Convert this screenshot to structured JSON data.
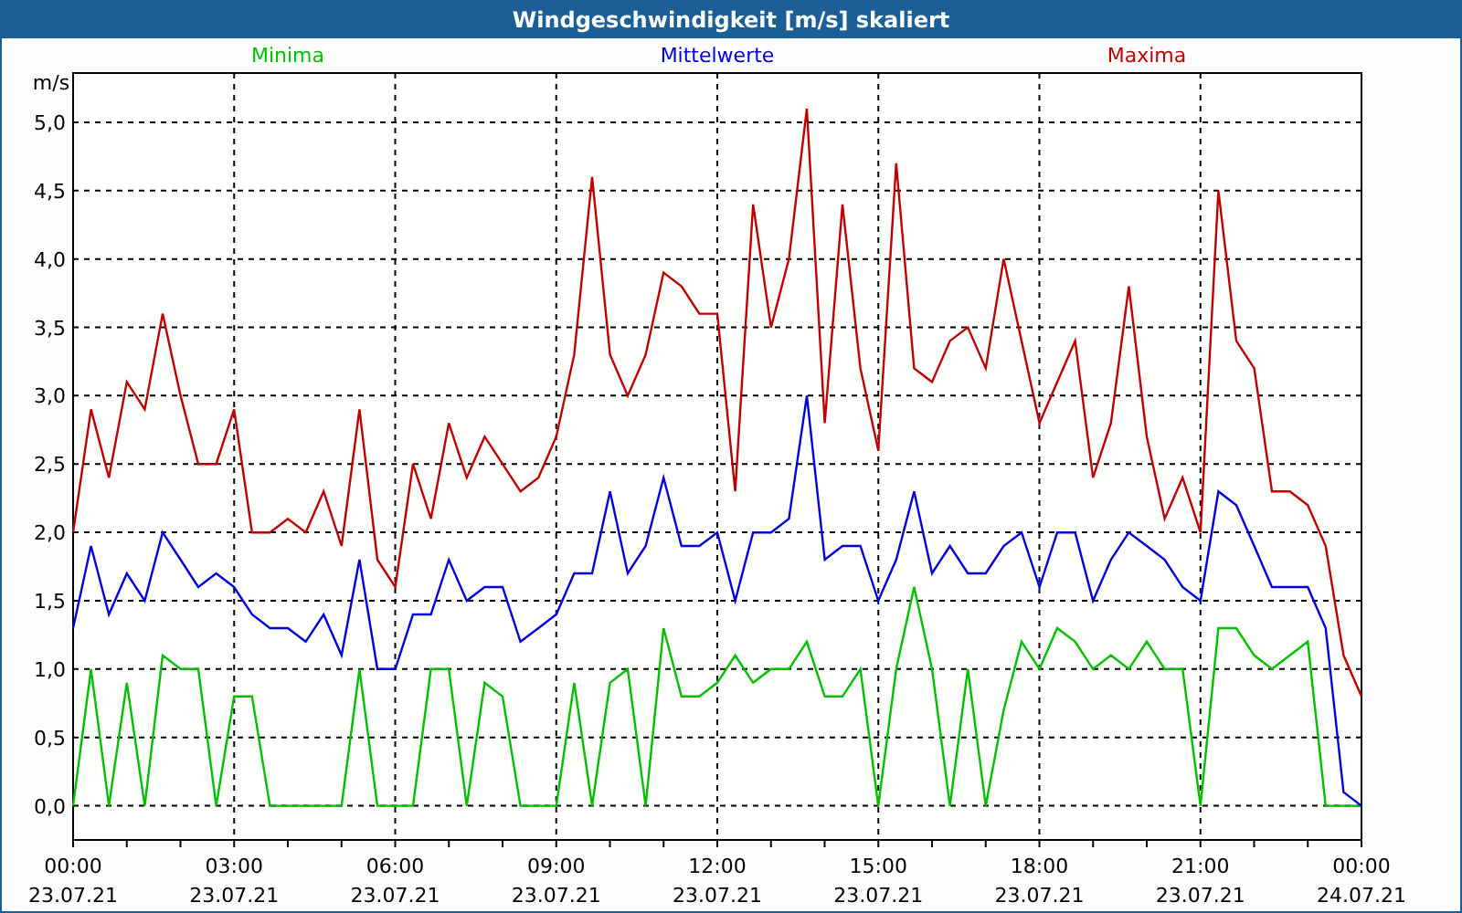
{
  "window": {
    "title": "Windgeschwindigkeit [m/s] skaliert"
  },
  "chart": {
    "chart_data": {
      "type": "line",
      "ylabel": "m/s",
      "categories": [
        "00:00 23.07.21",
        null,
        null,
        null,
        null,
        null,
        null,
        null,
        null,
        "03:00 23.07.21",
        null,
        null,
        null,
        null,
        null,
        null,
        null,
        null,
        "06:00 23.07.21",
        null,
        null,
        null,
        null,
        null,
        null,
        null,
        null,
        "09:00 23.07.21",
        null,
        null,
        null,
        null,
        null,
        null,
        null,
        null,
        "12:00 23.07.21",
        null,
        null,
        null,
        null,
        null,
        null,
        null,
        null,
        "15:00 23.07.21",
        null,
        null,
        null,
        null,
        null,
        null,
        null,
        null,
        "18:00 23.07.21",
        null,
        null,
        null,
        null,
        null,
        null,
        null,
        null,
        "21:00 23.07.21",
        null,
        null,
        null,
        null,
        null,
        null,
        null,
        null,
        "00:00 24.07.21"
      ],
      "series": [
        {
          "name": "Minima",
          "color": "#00c000",
          "values": [
            0.0,
            1.0,
            0.0,
            0.9,
            0.0,
            1.1,
            1.0,
            1.0,
            0.0,
            0.8,
            0.8,
            0.0,
            0.0,
            0.0,
            0.0,
            0.0,
            1.0,
            0.0,
            0.0,
            0.0,
            1.0,
            1.0,
            0.0,
            0.9,
            0.8,
            0.0,
            0.0,
            0.0,
            0.9,
            0.0,
            0.9,
            1.0,
            0.0,
            1.3,
            0.8,
            0.8,
            0.9,
            1.1,
            0.9,
            1.0,
            1.0,
            1.2,
            0.8,
            0.8,
            1.0,
            0.0,
            1.0,
            1.6,
            1.0,
            0.0,
            1.0,
            0.0,
            0.7,
            1.2,
            1.0,
            1.3,
            1.2,
            1.0,
            1.1,
            1.0,
            1.2,
            1.0,
            1.0,
            0.0,
            1.3,
            1.3,
            1.1,
            1.0,
            1.1,
            1.2,
            0.0,
            0.0,
            0.0
          ]
        },
        {
          "name": "Mittelwerte",
          "color": "#0000e0",
          "values": [
            1.3,
            1.9,
            1.4,
            1.7,
            1.5,
            2.0,
            1.8,
            1.6,
            1.7,
            1.6,
            1.4,
            1.3,
            1.3,
            1.2,
            1.4,
            1.1,
            1.8,
            1.0,
            1.0,
            1.4,
            1.4,
            1.8,
            1.5,
            1.6,
            1.6,
            1.2,
            1.3,
            1.4,
            1.7,
            1.7,
            2.3,
            1.7,
            1.9,
            2.4,
            1.9,
            1.9,
            2.0,
            1.5,
            2.0,
            2.0,
            2.1,
            3.0,
            1.8,
            1.9,
            1.9,
            1.5,
            1.8,
            2.3,
            1.7,
            1.9,
            1.7,
            1.7,
            1.9,
            2.0,
            1.6,
            2.0,
            2.0,
            1.5,
            1.8,
            2.0,
            1.9,
            1.8,
            1.6,
            1.5,
            2.3,
            2.2,
            1.9,
            1.6,
            1.6,
            1.6,
            1.3,
            0.1,
            0.0
          ]
        },
        {
          "name": "Maxima",
          "color": "#c00000",
          "values": [
            2.0,
            2.9,
            2.4,
            3.1,
            2.9,
            3.6,
            3.0,
            2.5,
            2.5,
            2.9,
            2.0,
            2.0,
            2.1,
            2.0,
            2.3,
            1.9,
            2.9,
            1.8,
            1.6,
            2.5,
            2.1,
            2.8,
            2.4,
            2.7,
            2.5,
            2.3,
            2.4,
            2.7,
            3.3,
            4.6,
            3.3,
            3.0,
            3.3,
            3.9,
            3.8,
            3.6,
            3.6,
            2.3,
            4.4,
            3.5,
            4.0,
            5.1,
            2.8,
            4.4,
            3.2,
            2.6,
            4.7,
            3.2,
            3.1,
            3.4,
            3.5,
            3.2,
            4.0,
            3.4,
            2.8,
            3.1,
            3.4,
            2.4,
            2.8,
            3.8,
            2.7,
            2.1,
            2.4,
            2.0,
            4.5,
            3.4,
            3.2,
            2.3,
            2.3,
            2.2,
            1.9,
            1.1,
            0.8
          ]
        }
      ],
      "ylim": [
        -0.25,
        5.36
      ],
      "grid": true,
      "yticks": [
        {
          "value": 0,
          "label": "0,0"
        },
        {
          "value": 0.5,
          "label": "0,5"
        },
        {
          "value": 1,
          "label": "1,0"
        },
        {
          "value": 1.5,
          "label": "1,5"
        },
        {
          "value": 2,
          "label": "2,0"
        },
        {
          "value": 2.5,
          "label": "2,5"
        },
        {
          "value": 3,
          "label": "3,0"
        },
        {
          "value": 3.5,
          "label": "3,5"
        },
        {
          "value": 4,
          "label": "4,0"
        },
        {
          "value": 4.5,
          "label": "4,5"
        },
        {
          "value": 5,
          "label": "5,0"
        }
      ]
    }
  }
}
